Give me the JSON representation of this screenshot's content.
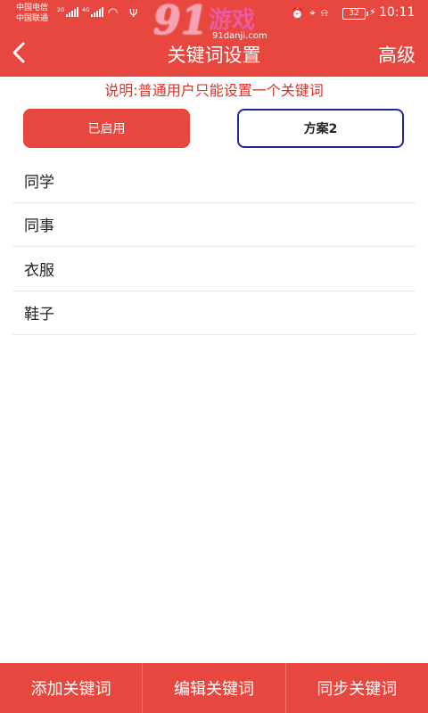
{
  "status_bar": {
    "carrier1": "中国电信",
    "carrier2": "中国联通",
    "signal1_label": "2G",
    "signal2_label": "4G",
    "battery": "32",
    "time": "10:11"
  },
  "watermark": {
    "logo_number": "91",
    "logo_text": "游戏",
    "url": "91danji.com"
  },
  "navbar": {
    "title": "关键词设置",
    "advanced": "高级"
  },
  "notice": "说明:普通用户只能设置一个关键词",
  "schemes": {
    "active": "已启用",
    "inactive": "方案2"
  },
  "keywords": [
    "同学",
    "同事",
    "衣服",
    "鞋子"
  ],
  "bottom_bar": {
    "add": "添加关键词",
    "edit": "编辑关键词",
    "sync": "同步关键词"
  },
  "colors": {
    "primary": "#e8473f",
    "notice": "#d8322a",
    "inactive_border": "#1f2a8c"
  },
  "icons": [
    "back-icon",
    "wifi-icon",
    "usb-icon",
    "alarm-icon",
    "location-icon",
    "mute-icon",
    "battery-icon",
    "charging-icon"
  ]
}
